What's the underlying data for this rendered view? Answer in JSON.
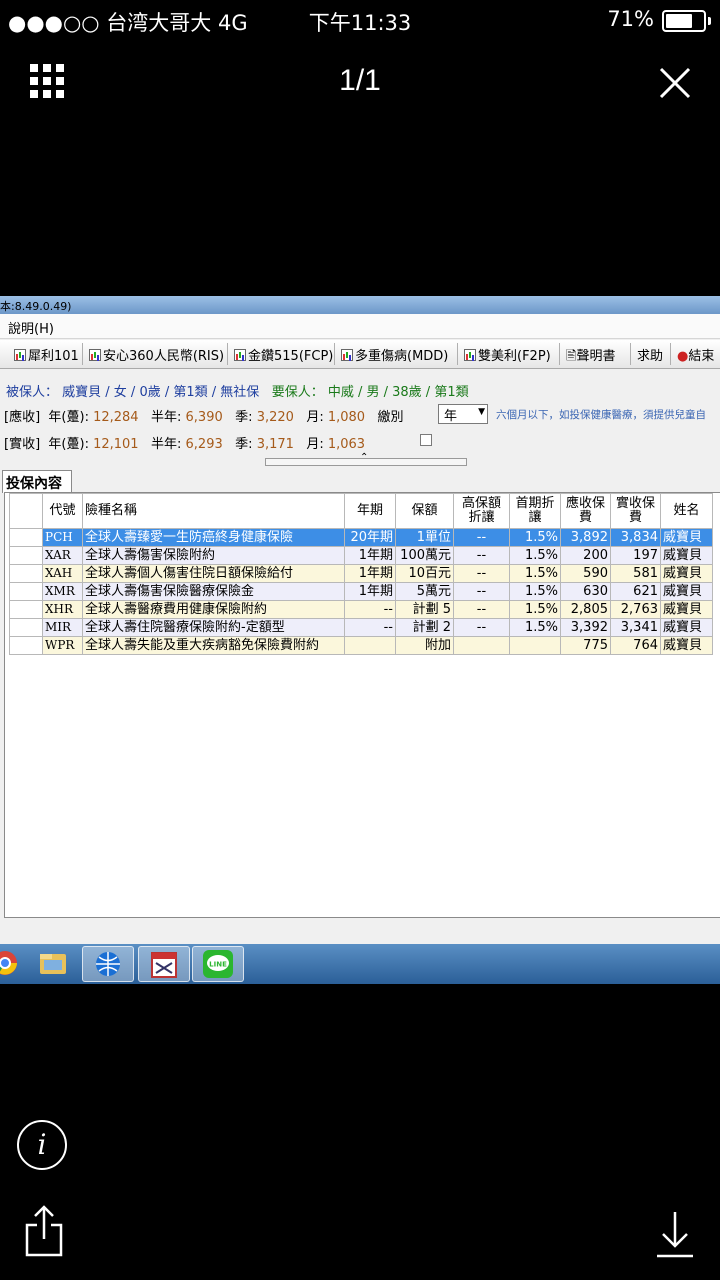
{
  "status_bar": {
    "carrier": "●●●○○ 台湾大哥大   4G",
    "time": "下午11:33",
    "battery_text": "71%",
    "battery_level": 0.71
  },
  "viewer": {
    "page_count": "1/1"
  },
  "app": {
    "title_fragment": "本:8.49.0.49)",
    "menu": {
      "help": "說明(H)"
    },
    "toolbar": [
      "犀利101",
      "安心360人民幣(RIS)",
      "金鑽515(FCP)",
      "多重傷病(MDD)",
      "雙美利(F2P)",
      "聲明書",
      "求助",
      "結束"
    ],
    "insured": {
      "insured_label": "被保人：",
      "insured_value": "威寶貝 / 女 / 0歲 / 第1類 / 無社保",
      "applicant_label": "要保人：",
      "applicant_value": "中威 / 男 / 38歲 / 第1類"
    },
    "due": {
      "label": "[應收]",
      "annual_label": "年(躉):",
      "annual": "12,284",
      "half_label": "半年:",
      "half": "6,390",
      "quarter_label": "季:",
      "quarter": "3,220",
      "month_label": "月:",
      "month": "1,080",
      "mode_label": "繳別",
      "mode_value": "年"
    },
    "actual": {
      "label": "[實收]",
      "annual_label": "年(躉):",
      "annual": "12,101",
      "half_label": "半年:",
      "half": "6,293",
      "quarter_label": "季:",
      "quarter": "3,171",
      "month_label": "月:",
      "month": "1,063"
    },
    "note": "六個月以下，如投保健康醫療，須提供兒童自",
    "tab": "投保內容",
    "columns": [
      "代號",
      "險種名稱",
      "年期",
      "保額",
      "高保額折讓",
      "首期折讓",
      "應收保費",
      "實收保費",
      "姓名"
    ],
    "rows": [
      {
        "code": "PCH",
        "name": "全球人壽臻愛一生防癌終身健康保險",
        "term": "20年期",
        "amount": "1單位",
        "high_disc": "--",
        "first_disc": "1.5%",
        "due": "3,892",
        "actual": "3,834",
        "person": "威寶貝",
        "selected": true
      },
      {
        "code": "XAR",
        "name": "全球人壽傷害保險附約",
        "term": "1年期",
        "amount": "100萬元",
        "high_disc": "--",
        "first_disc": "1.5%",
        "due": "200",
        "actual": "197",
        "person": "威寶貝"
      },
      {
        "code": "XAH",
        "name": "全球人壽個人傷害住院日額保險給付",
        "term": "1年期",
        "amount": "10百元",
        "high_disc": "--",
        "first_disc": "1.5%",
        "due": "590",
        "actual": "581",
        "person": "威寶貝"
      },
      {
        "code": "XMR",
        "name": "全球人壽傷害保險醫療保險金",
        "term": "1年期",
        "amount": "5萬元",
        "high_disc": "--",
        "first_disc": "1.5%",
        "due": "630",
        "actual": "621",
        "person": "威寶貝"
      },
      {
        "code": "XHR",
        "name": "全球人壽醫療費用健康保險附約",
        "term": "--",
        "amount": "計劃 5",
        "high_disc": "--",
        "first_disc": "1.5%",
        "due": "2,805",
        "actual": "2,763",
        "person": "威寶貝"
      },
      {
        "code": "MIR",
        "name": "全球人壽住院醫療保險附約-定額型",
        "term": "--",
        "amount": "計劃 2",
        "high_disc": "--",
        "first_disc": "1.5%",
        "due": "3,392",
        "actual": "3,341",
        "person": "威寶貝"
      },
      {
        "code": "WPR",
        "name": "全球人壽失能及重大疾病豁免保險費附約",
        "term": "",
        "amount": "附加",
        "high_disc": "",
        "first_disc": "",
        "due": "775",
        "actual": "764",
        "person": "威寶貝"
      }
    ]
  },
  "taskbar_icons": [
    "chrome-icon",
    "file-explorer-icon",
    "ie-icon",
    "calendar-app-icon",
    "line-icon"
  ],
  "line_label": "LINE",
  "colors": {
    "selected_row": "#3d8ee6",
    "odd_row": "#eeeefa",
    "even_row": "#fbf7dc",
    "taskbar": "#2b5f98"
  }
}
